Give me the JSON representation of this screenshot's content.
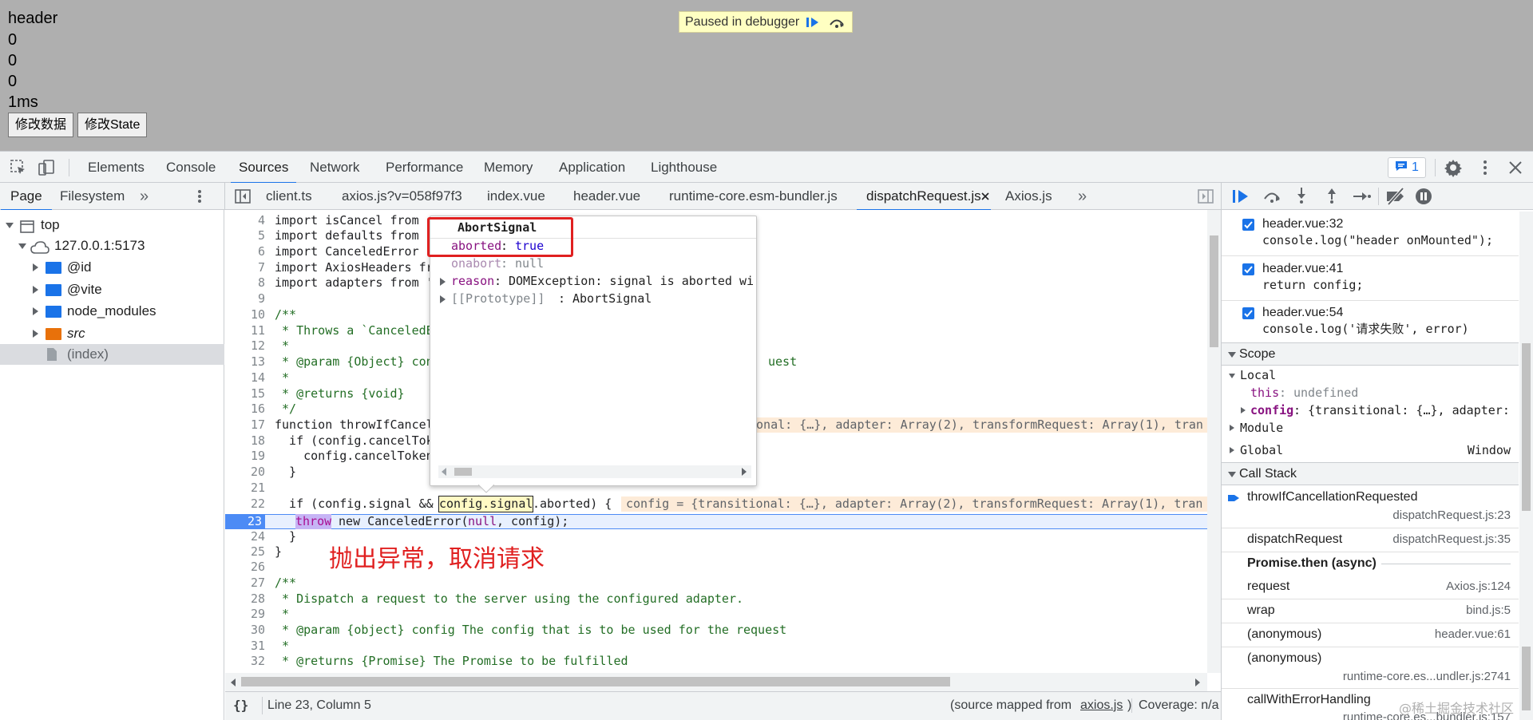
{
  "page": {
    "lines": [
      "header",
      "0",
      "0",
      "0",
      "1ms"
    ],
    "buttons": [
      "修改数据",
      "修改State"
    ],
    "paused_text": "Paused in debugger"
  },
  "devtools": {
    "tabs": [
      "Elements",
      "Console",
      "Sources",
      "Network",
      "Performance",
      "Memory",
      "Application",
      "Lighthouse"
    ],
    "active_tab": "Sources",
    "issues_count": "1",
    "accent": "#1a73e8"
  },
  "navigator": {
    "tabs": [
      "Page",
      "Filesystem"
    ],
    "more": "»",
    "tree": [
      "top",
      "127.0.0.1:5173",
      "@id",
      "@vite",
      "node_modules",
      "src",
      "(index)"
    ]
  },
  "editor_tabs": [
    "client.ts",
    "axios.js?v=058f97f3",
    "index.vue",
    "header.vue",
    "runtime-core.esm-bundler.js",
    "dispatchRequest.js",
    "Axios.js"
  ],
  "editor_tabs_more": "»",
  "active_file": "dispatchRequest.js",
  "code": {
    "line_numbers": [
      "4",
      "5",
      "6",
      "7",
      "8",
      "9",
      "10",
      "11",
      "12",
      "13",
      "14",
      "15",
      "16",
      "17",
      "18",
      "19",
      "20",
      "21",
      "22",
      "23",
      "24",
      "25",
      "26",
      "27",
      "28",
      "29",
      "30",
      "31",
      "32"
    ],
    "l4": "import isCancel from ",
    "l5": "import defaults from '",
    "l6": "import CanceledError",
    "l7": "import AxiosHeaders fr",
    "l8": "import adapters from '",
    "l10": "/**",
    "l11": " * Throws a `CanceledE",
    "l12": " *",
    "l13a": " * @param {Object} con",
    "l13b": "uest",
    "l14": " *",
    "l15": " * @returns {void}",
    "l16": " */",
    "l17": "function throwIfCancel",
    "l17_inline": "ional: {…}, adapter: Array(2), transformRequest: Array(1), tran",
    "l18": "  if (config.cancelTok",
    "l19": "    config.cancelToken",
    "l20": "  }",
    "l22a": "  if (config.signal && ",
    "l22b": "config.signal",
    "l22c": ".aborted) {",
    "l22_inline": "config = {transitional: {…}, adapter: Array(2), transformRequest: Array(1), tran",
    "l23a": "throw",
    "l23b": " new CanceledError(",
    "l23c": "null",
    "l23d": ", config);",
    "l24": "  }",
    "l25": "}",
    "l27": "/**",
    "l28": " * Dispatch a request to the server using the configured adapter.",
    "l29": " *",
    "l30": " * @param {object} config The config that is to be used for the request",
    "l31": " *",
    "l32": " * @returns {Promise} The Promise to be fulfilled"
  },
  "annotation": "抛出异常，取消请求",
  "popover": {
    "title": "AbortSignal",
    "aborted_key": "aborted",
    "aborted_val": "true",
    "onabort_key": "onabort",
    "onabort_val": "null",
    "reason_key": "reason",
    "reason_val": "DOMException: signal is aborted wi",
    "proto_key": "[[Prototype]]",
    "proto_val": "AbortSignal"
  },
  "breakpoints": [
    {
      "file": "header.vue:32",
      "code": "console.log(\"header onMounted\");"
    },
    {
      "file": "header.vue:41",
      "code": "return config;"
    },
    {
      "file": "header.vue:54",
      "code": "console.log('请求失败', error)"
    }
  ],
  "scope": {
    "title": "Scope",
    "local": "Local",
    "this_key": "this",
    "this_val": "undefined",
    "config_key": "config",
    "config_val": "{transitional: {…}, adapter:",
    "module": "Module",
    "global": "Global",
    "global_val": "Window"
  },
  "call_stack": {
    "title": "Call Stack",
    "frames": [
      {
        "name": "throwIfCancellationRequested",
        "file": "dispatchRequest.js:23"
      },
      {
        "name": "dispatchRequest",
        "file": "dispatchRequest.js:35"
      },
      {
        "name": "Promise.then (async)",
        "file": ""
      },
      {
        "name": "request",
        "file": "Axios.js:124"
      },
      {
        "name": "wrap",
        "file": "bind.js:5"
      },
      {
        "name": "(anonymous)",
        "file": "header.vue:61"
      },
      {
        "name": "(anonymous)",
        "file": "runtime-core.es...undler.js:2741"
      },
      {
        "name": "callWithErrorHandling",
        "file": "runtime-core.es...bundler.js:157"
      }
    ]
  },
  "status": {
    "braces": "{}",
    "position": "Line 23, Column 5",
    "source_mapped": "(source mapped from ",
    "source_file": "axios.js",
    "source_close": ")",
    "coverage": "Coverage: n/a"
  },
  "watermark": "@稀土掘金技术社区"
}
